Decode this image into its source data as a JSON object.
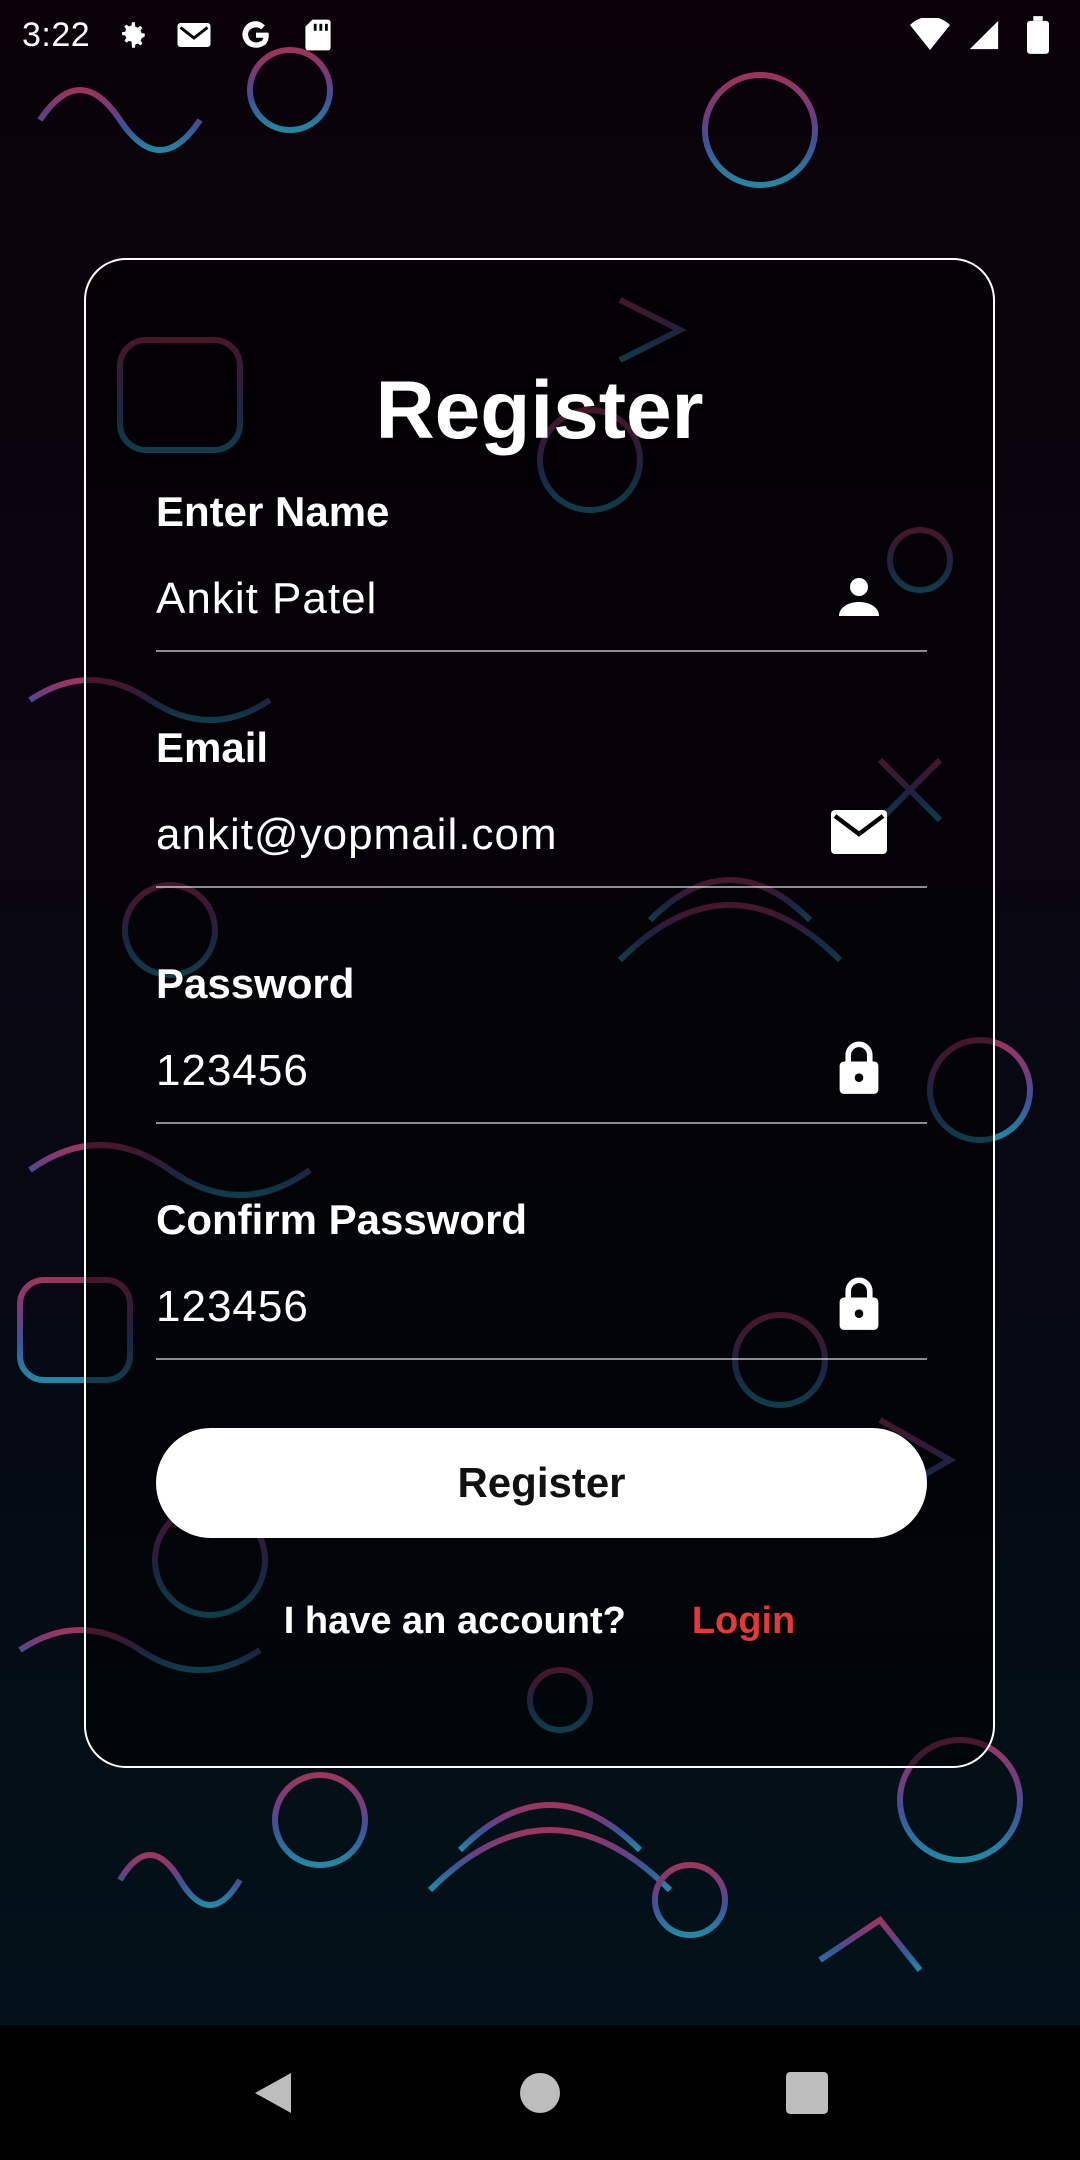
{
  "status_bar": {
    "time": "3:22",
    "left_icons": [
      "settings-icon",
      "gmail-icon",
      "google-icon",
      "sd-card-icon"
    ],
    "right_icons": [
      "wifi-icon",
      "signal-icon",
      "battery-icon"
    ]
  },
  "form": {
    "title": "Register",
    "fields": [
      {
        "label": "Enter Name",
        "value": "Ankit Patel",
        "icon": "person-icon"
      },
      {
        "label": "Email",
        "value": "ankit@yopmail.com",
        "icon": "mail-icon"
      },
      {
        "label": "Password",
        "value": "123456",
        "icon": "lock-icon"
      },
      {
        "label": "Confirm Password",
        "value": "123456",
        "icon": "lock-icon"
      }
    ],
    "register_button": "Register",
    "account_prompt": "I have an account?",
    "login_link": "Login"
  },
  "colors": {
    "accent_login": "#e53935",
    "button_bg": "#ffffff",
    "card_border": "#ffffff"
  },
  "nav_bar": {
    "buttons": [
      "back-icon",
      "home-icon",
      "recents-icon"
    ]
  }
}
